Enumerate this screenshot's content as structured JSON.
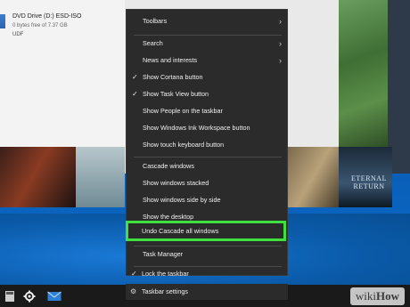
{
  "explorer": {
    "drive_name": "DVD Drive (D:) ESD-ISO",
    "drive_free": "0 bytes free of 7.37 GB",
    "drive_fs": "UDF"
  },
  "thumbnail_text": "ETERNAL RETURN",
  "context_menu": {
    "items": [
      {
        "label": "Toolbars",
        "checked": false,
        "submenu": true
      },
      {
        "label": "Search",
        "checked": false,
        "submenu": true
      },
      {
        "label": "News and interests",
        "checked": false,
        "submenu": true
      },
      {
        "label": "Show Cortana button",
        "checked": true,
        "submenu": false
      },
      {
        "label": "Show Task View button",
        "checked": true,
        "submenu": false
      },
      {
        "label": "Show People on the taskbar",
        "checked": false,
        "submenu": false
      },
      {
        "label": "Show Windows Ink Workspace button",
        "checked": false,
        "submenu": false
      },
      {
        "label": "Show touch keyboard button",
        "checked": false,
        "submenu": false
      },
      {
        "label": "Cascade windows",
        "checked": false,
        "submenu": false
      },
      {
        "label": "Show windows stacked",
        "checked": false,
        "submenu": false
      },
      {
        "label": "Show windows side by side",
        "checked": false,
        "submenu": false
      },
      {
        "label": "Show the desktop",
        "checked": false,
        "submenu": false
      },
      {
        "label": "Undo Cascade all windows",
        "checked": false,
        "submenu": false,
        "highlighted": true
      },
      {
        "label": "Task Manager",
        "checked": false,
        "submenu": false
      },
      {
        "label": "Lock the taskbar",
        "checked": true,
        "submenu": false
      },
      {
        "label": "Taskbar settings",
        "checked": false,
        "submenu": false,
        "icon": "gear-icon"
      }
    ],
    "check_glyph": "✓",
    "arrow_glyph": "›",
    "gear_glyph": "⚙"
  },
  "watermark": {
    "prefix": "wiki",
    "suffix": "How"
  },
  "colors": {
    "menu_bg": "#2b2b2b",
    "highlight_border": "#3fe13f",
    "taskbar_bg": "#1a1a1a"
  },
  "taskbar": {
    "icons": [
      "calculator-icon",
      "settings-icon",
      "mail-icon"
    ]
  }
}
